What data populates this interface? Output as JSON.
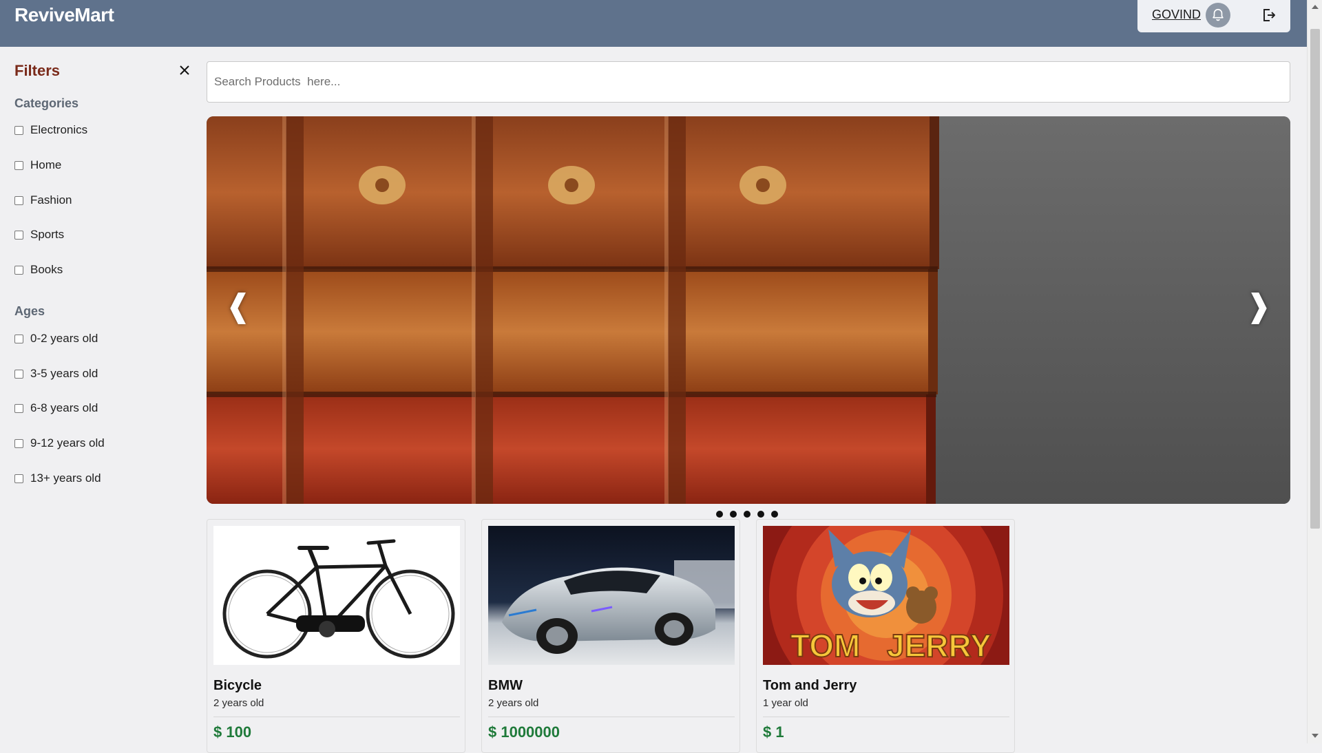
{
  "header": {
    "brand": "ReviveMart",
    "user_name": "GOVIND",
    "bell_icon": "bell-icon",
    "logout_icon": "logout-icon",
    "bg_color": "#5f728c"
  },
  "sidebar": {
    "title": "Filters",
    "close_icon": "close-icon",
    "categories": {
      "title": "Categories",
      "options": [
        "Electronics",
        "Home",
        "Fashion",
        "Sports",
        "Books"
      ]
    },
    "ages": {
      "title": "Ages",
      "options": [
        "0-2 years old",
        "3-5 years old",
        "6-8 years old",
        "9-12 years old",
        "13+ years old"
      ]
    }
  },
  "search": {
    "placeholder": "Search Products  here...",
    "value": ""
  },
  "carousel": {
    "prev_glyph": "❰",
    "next_glyph": "❱",
    "slide_count": 5,
    "active_slide": 1,
    "current_image": "stacked-old-leather-books"
  },
  "products": [
    {
      "name": "Bicycle",
      "age": "2 years old",
      "price": "$ 100",
      "image": "bicycle"
    },
    {
      "name": "BMW",
      "age": "2 years old",
      "price": "$ 1000000",
      "image": "silver-bmw-i8-car"
    },
    {
      "name": "Tom and Jerry",
      "age": "1 year old",
      "price": "$ 1",
      "image": "tom-and-jerry-cartoon"
    }
  ],
  "colors": {
    "filters_title": "#7a2a1a",
    "section_title": "#5d6774",
    "price": "#1f7a3a"
  }
}
